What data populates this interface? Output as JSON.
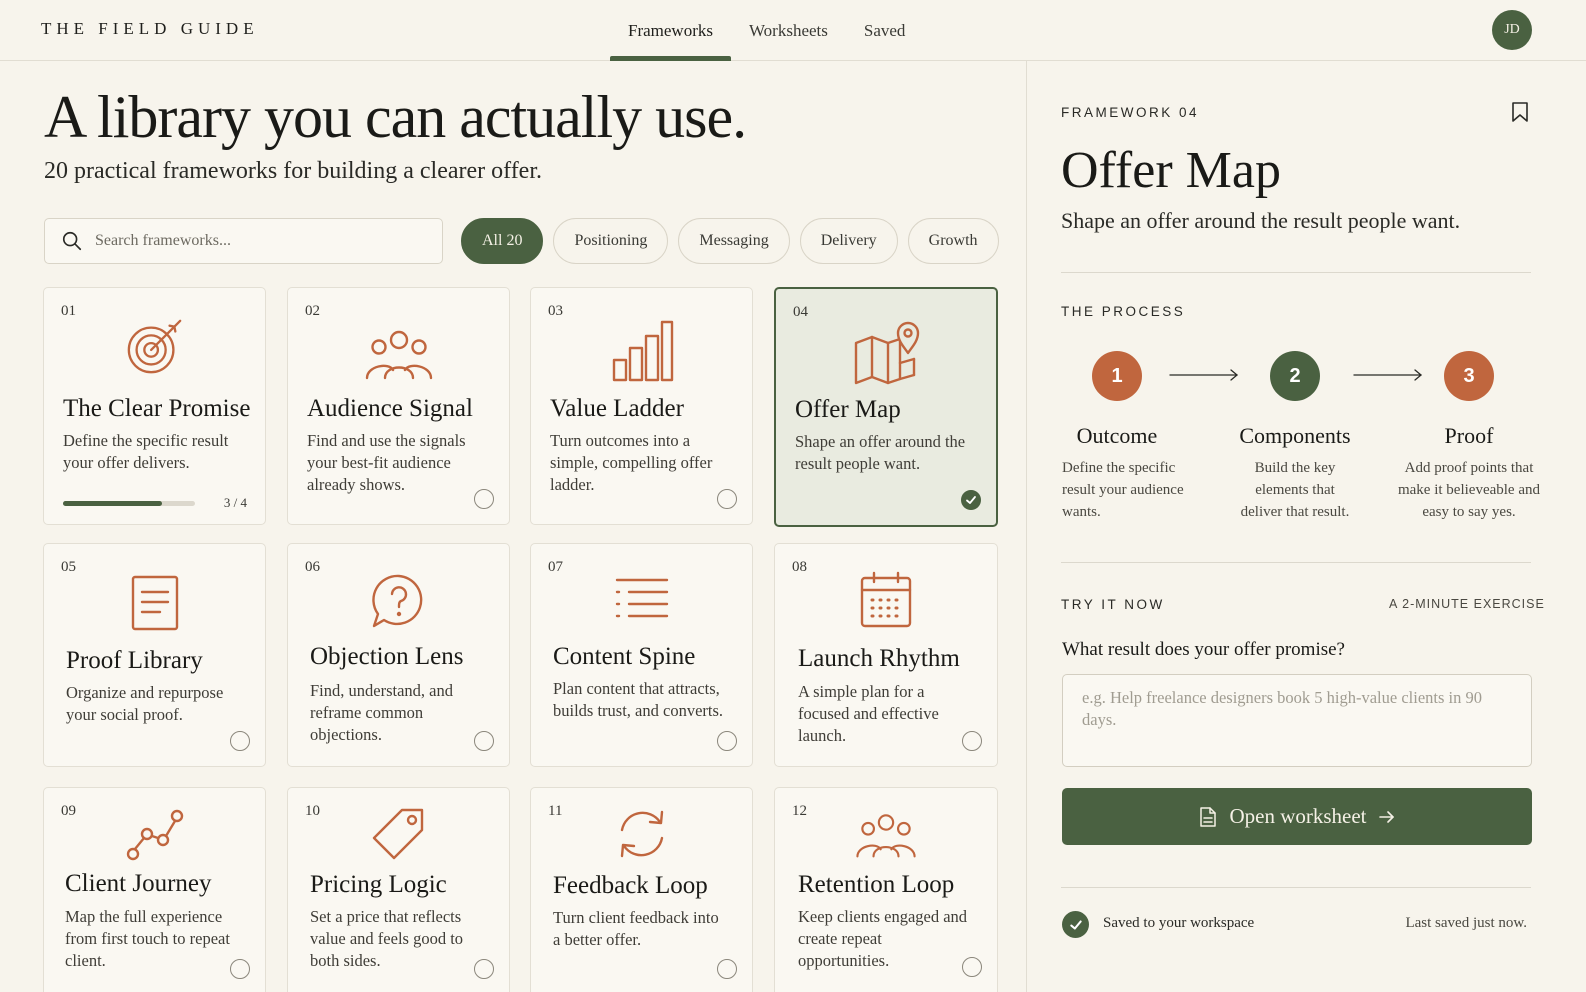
{
  "app": {
    "brand": "THE FIELD GUIDE",
    "nav": [
      "Frameworks",
      "Worksheets",
      "Saved"
    ],
    "active_nav": 0,
    "user_initials": "JD"
  },
  "colors": {
    "accent_green": "#4a6141",
    "terracotta": "#c0663e",
    "background": "#f7f4ec"
  },
  "hero": {
    "title": "A library you can actually use.",
    "subtitle": "20 practical frameworks for building a clearer offer."
  },
  "search": {
    "placeholder": "Search frameworks..."
  },
  "filters": [
    "All 20",
    "Positioning",
    "Messaging",
    "Delivery",
    "Growth"
  ],
  "cards": [
    {
      "num": "01",
      "icon": "target-icon",
      "title": "The Clear Promise",
      "desc": "Define the specific result your offer delivers.",
      "progress": 0.75,
      "progress_label": "3 / 4"
    },
    {
      "num": "02",
      "icon": "people-icon",
      "title": "Audience Signal",
      "desc": "Find and use the signals your best-fit audience already shows."
    },
    {
      "num": "03",
      "icon": "bar-chart-icon",
      "title": "Value Ladder",
      "desc": "Turn outcomes into a simple, compelling offer ladder."
    },
    {
      "num": "04",
      "icon": "map-pin-icon",
      "title": "Offer Map",
      "desc": "Shape an offer around the result people want.",
      "selected": true
    },
    {
      "num": "05",
      "icon": "document-icon",
      "title": "Proof Library",
      "desc": "Organize and repurpose your social proof."
    },
    {
      "num": "06",
      "icon": "question-bubble-icon",
      "title": "Objection Lens",
      "desc": "Find, understand, and reframe common objections."
    },
    {
      "num": "07",
      "icon": "list-icon",
      "title": "Content Spine",
      "desc": "Plan content that attracts, builds trust, and converts."
    },
    {
      "num": "08",
      "icon": "calendar-icon",
      "title": "Launch Rhythm",
      "desc": "A simple plan for a focused and effective launch."
    },
    {
      "num": "09",
      "icon": "journey-path-icon",
      "title": "Client Journey",
      "desc": "Map the full experience from first touch to repeat client."
    },
    {
      "num": "10",
      "icon": "price-tag-icon",
      "title": "Pricing Logic",
      "desc": "Set a price that reflects value and feels good to both sides."
    },
    {
      "num": "11",
      "icon": "refresh-loop-icon",
      "title": "Feedback Loop",
      "desc": "Turn client feedback into a better offer."
    },
    {
      "num": "12",
      "icon": "people-icon",
      "title": "Retention Loop",
      "desc": "Keep clients engaged and create repeat opportunities."
    }
  ],
  "detail": {
    "eyebrow": "FRAMEWORK 04",
    "title": "Offer Map",
    "subtitle": "Shape an offer around the result people want.",
    "process_label": "THE PROCESS",
    "steps": [
      {
        "n": "1",
        "title": "Outcome",
        "desc": "Define the specific result your audience wants."
      },
      {
        "n": "2",
        "title": "Components",
        "desc": "Build the key elements that deliver that result."
      },
      {
        "n": "3",
        "title": "Proof",
        "desc": "Add proof points that make it believeable and easy to say yes."
      }
    ],
    "try_label": "TRY IT NOW",
    "exercise_label": "A 2-MINUTE EXERCISE",
    "question": "What result does your offer promise?",
    "answer_placeholder": "e.g. Help freelance designers book 5 high-value clients in 90 days.",
    "cta": "Open worksheet",
    "saved_text": "Saved to your workspace",
    "last_saved": "Last saved just now."
  }
}
